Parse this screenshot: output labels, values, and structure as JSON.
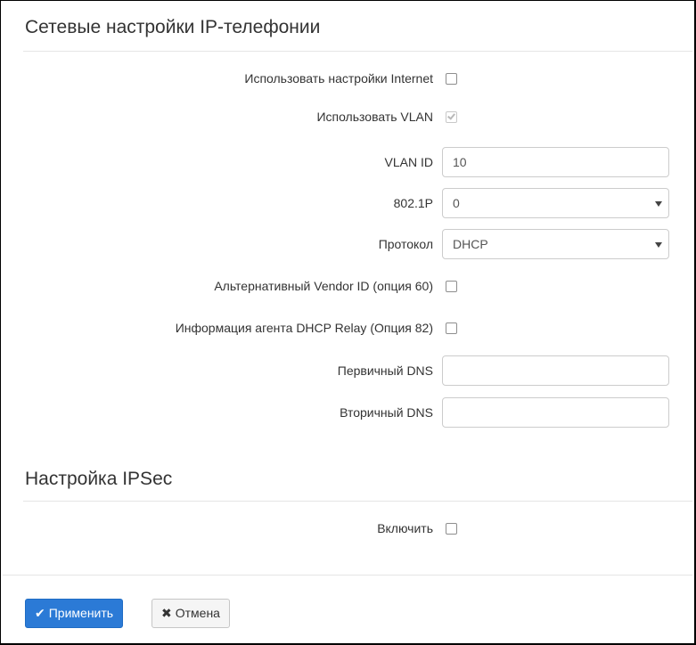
{
  "network_section": {
    "title": "Сетевые настройки IP-телефонии",
    "use_internet_settings": {
      "label": "Использовать настройки Internet",
      "checked": false
    },
    "use_vlan": {
      "label": "Использовать VLAN",
      "checked": true,
      "disabled": true
    },
    "vlan_id": {
      "label": "VLAN ID",
      "value": "10"
    },
    "priority_8021p": {
      "label": "802.1P",
      "value": "0"
    },
    "protocol": {
      "label": "Протокол",
      "value": "DHCP"
    },
    "alt_vendor_id": {
      "label": "Альтернативный Vendor ID (опция 60)",
      "checked": false
    },
    "dhcp_relay_info": {
      "label": "Информация агента DHCP Relay (Опция 82)",
      "checked": false
    },
    "primary_dns": {
      "label": "Первичный DNS",
      "value": ""
    },
    "secondary_dns": {
      "label": "Вторичный DNS",
      "value": ""
    }
  },
  "ipsec_section": {
    "title": "Настройка IPSec",
    "enable": {
      "label": "Включить",
      "checked": false
    }
  },
  "footer": {
    "apply_label": "Применить",
    "apply_icon": "checkmark-icon",
    "cancel_label": "Отмена",
    "cancel_icon": "cross-icon"
  },
  "colors": {
    "primary_button": "#2b7ad6",
    "default_button": "#f5f5f5"
  }
}
